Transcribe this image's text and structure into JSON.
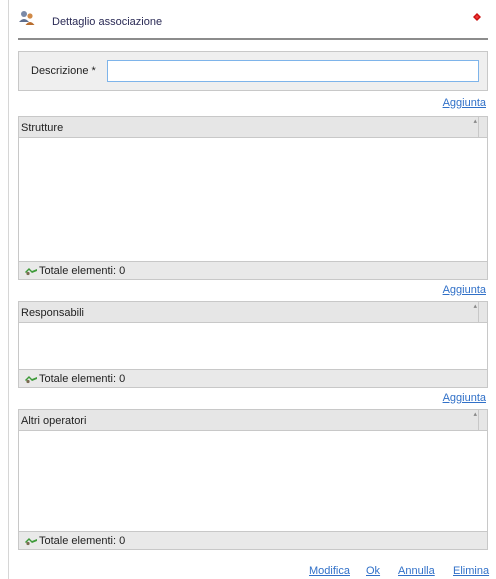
{
  "header": {
    "title": "Dettaglio associazione",
    "icon": "users-icon",
    "close_icon": "close-icon",
    "accent_close": "#cc1111"
  },
  "form": {
    "descrizione_label": "Descrizione *",
    "descrizione_value": "",
    "descrizione_placeholder": ""
  },
  "sections": {
    "strutture": {
      "add_label": "Aggiunta",
      "column_header": "Strutture",
      "footer": "Totale elementi: 0"
    },
    "responsabili": {
      "add_label": "Aggiunta",
      "column_header": "Responsabili",
      "footer": "Totale elementi: 0"
    },
    "altri_operatori": {
      "add_label": "Aggiunta",
      "column_header": "Altri operatori",
      "footer": "Totale elementi: 0"
    }
  },
  "actions": {
    "modifica": "Modifica",
    "ok": "Ok",
    "annulla": "Annulla",
    "elimina": "Elimina"
  },
  "colors": {
    "link": "#3070c8",
    "input_border": "#7eb4ea",
    "grid_header_bg": "#e6e6e6"
  }
}
